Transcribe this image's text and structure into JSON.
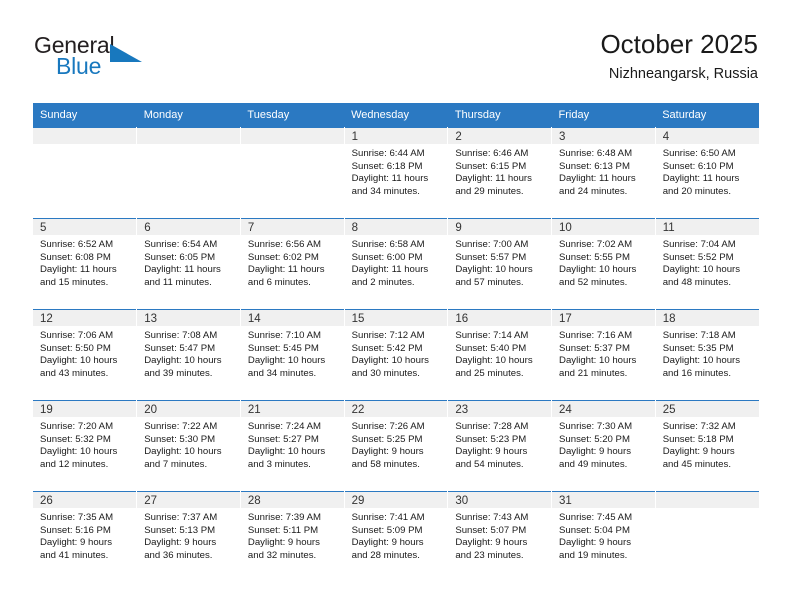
{
  "brand": {
    "name_part1": "General",
    "name_part2": "Blue",
    "triangle_icon": "triangle-icon",
    "accent_color": "#1878be"
  },
  "header": {
    "title": "October 2025",
    "subtitle": "Nizhneangarsk, Russia"
  },
  "theme": {
    "header_row_bg": "#2b79c2",
    "daynum_band_bg": "#f0f0f0",
    "text_color": "#1a1a1a"
  },
  "weekdays": [
    "Sunday",
    "Monday",
    "Tuesday",
    "Wednesday",
    "Thursday",
    "Friday",
    "Saturday"
  ],
  "weeks": [
    [
      {
        "day": "",
        "empty": true
      },
      {
        "day": "",
        "empty": true
      },
      {
        "day": "",
        "empty": true
      },
      {
        "day": "1",
        "sunrise": "Sunrise: 6:44 AM",
        "sunset": "Sunset: 6:18 PM",
        "daylight1": "Daylight: 11 hours",
        "daylight2": "and 34 minutes."
      },
      {
        "day": "2",
        "sunrise": "Sunrise: 6:46 AM",
        "sunset": "Sunset: 6:15 PM",
        "daylight1": "Daylight: 11 hours",
        "daylight2": "and 29 minutes."
      },
      {
        "day": "3",
        "sunrise": "Sunrise: 6:48 AM",
        "sunset": "Sunset: 6:13 PM",
        "daylight1": "Daylight: 11 hours",
        "daylight2": "and 24 minutes."
      },
      {
        "day": "4",
        "sunrise": "Sunrise: 6:50 AM",
        "sunset": "Sunset: 6:10 PM",
        "daylight1": "Daylight: 11 hours",
        "daylight2": "and 20 minutes."
      }
    ],
    [
      {
        "day": "5",
        "sunrise": "Sunrise: 6:52 AM",
        "sunset": "Sunset: 6:08 PM",
        "daylight1": "Daylight: 11 hours",
        "daylight2": "and 15 minutes."
      },
      {
        "day": "6",
        "sunrise": "Sunrise: 6:54 AM",
        "sunset": "Sunset: 6:05 PM",
        "daylight1": "Daylight: 11 hours",
        "daylight2": "and 11 minutes."
      },
      {
        "day": "7",
        "sunrise": "Sunrise: 6:56 AM",
        "sunset": "Sunset: 6:02 PM",
        "daylight1": "Daylight: 11 hours",
        "daylight2": "and 6 minutes."
      },
      {
        "day": "8",
        "sunrise": "Sunrise: 6:58 AM",
        "sunset": "Sunset: 6:00 PM",
        "daylight1": "Daylight: 11 hours",
        "daylight2": "and 2 minutes."
      },
      {
        "day": "9",
        "sunrise": "Sunrise: 7:00 AM",
        "sunset": "Sunset: 5:57 PM",
        "daylight1": "Daylight: 10 hours",
        "daylight2": "and 57 minutes."
      },
      {
        "day": "10",
        "sunrise": "Sunrise: 7:02 AM",
        "sunset": "Sunset: 5:55 PM",
        "daylight1": "Daylight: 10 hours",
        "daylight2": "and 52 minutes."
      },
      {
        "day": "11",
        "sunrise": "Sunrise: 7:04 AM",
        "sunset": "Sunset: 5:52 PM",
        "daylight1": "Daylight: 10 hours",
        "daylight2": "and 48 minutes."
      }
    ],
    [
      {
        "day": "12",
        "sunrise": "Sunrise: 7:06 AM",
        "sunset": "Sunset: 5:50 PM",
        "daylight1": "Daylight: 10 hours",
        "daylight2": "and 43 minutes."
      },
      {
        "day": "13",
        "sunrise": "Sunrise: 7:08 AM",
        "sunset": "Sunset: 5:47 PM",
        "daylight1": "Daylight: 10 hours",
        "daylight2": "and 39 minutes."
      },
      {
        "day": "14",
        "sunrise": "Sunrise: 7:10 AM",
        "sunset": "Sunset: 5:45 PM",
        "daylight1": "Daylight: 10 hours",
        "daylight2": "and 34 minutes."
      },
      {
        "day": "15",
        "sunrise": "Sunrise: 7:12 AM",
        "sunset": "Sunset: 5:42 PM",
        "daylight1": "Daylight: 10 hours",
        "daylight2": "and 30 minutes."
      },
      {
        "day": "16",
        "sunrise": "Sunrise: 7:14 AM",
        "sunset": "Sunset: 5:40 PM",
        "daylight1": "Daylight: 10 hours",
        "daylight2": "and 25 minutes."
      },
      {
        "day": "17",
        "sunrise": "Sunrise: 7:16 AM",
        "sunset": "Sunset: 5:37 PM",
        "daylight1": "Daylight: 10 hours",
        "daylight2": "and 21 minutes."
      },
      {
        "day": "18",
        "sunrise": "Sunrise: 7:18 AM",
        "sunset": "Sunset: 5:35 PM",
        "daylight1": "Daylight: 10 hours",
        "daylight2": "and 16 minutes."
      }
    ],
    [
      {
        "day": "19",
        "sunrise": "Sunrise: 7:20 AM",
        "sunset": "Sunset: 5:32 PM",
        "daylight1": "Daylight: 10 hours",
        "daylight2": "and 12 minutes."
      },
      {
        "day": "20",
        "sunrise": "Sunrise: 7:22 AM",
        "sunset": "Sunset: 5:30 PM",
        "daylight1": "Daylight: 10 hours",
        "daylight2": "and 7 minutes."
      },
      {
        "day": "21",
        "sunrise": "Sunrise: 7:24 AM",
        "sunset": "Sunset: 5:27 PM",
        "daylight1": "Daylight: 10 hours",
        "daylight2": "and 3 minutes."
      },
      {
        "day": "22",
        "sunrise": "Sunrise: 7:26 AM",
        "sunset": "Sunset: 5:25 PM",
        "daylight1": "Daylight: 9 hours",
        "daylight2": "and 58 minutes."
      },
      {
        "day": "23",
        "sunrise": "Sunrise: 7:28 AM",
        "sunset": "Sunset: 5:23 PM",
        "daylight1": "Daylight: 9 hours",
        "daylight2": "and 54 minutes."
      },
      {
        "day": "24",
        "sunrise": "Sunrise: 7:30 AM",
        "sunset": "Sunset: 5:20 PM",
        "daylight1": "Daylight: 9 hours",
        "daylight2": "and 49 minutes."
      },
      {
        "day": "25",
        "sunrise": "Sunrise: 7:32 AM",
        "sunset": "Sunset: 5:18 PM",
        "daylight1": "Daylight: 9 hours",
        "daylight2": "and 45 minutes."
      }
    ],
    [
      {
        "day": "26",
        "sunrise": "Sunrise: 7:35 AM",
        "sunset": "Sunset: 5:16 PM",
        "daylight1": "Daylight: 9 hours",
        "daylight2": "and 41 minutes."
      },
      {
        "day": "27",
        "sunrise": "Sunrise: 7:37 AM",
        "sunset": "Sunset: 5:13 PM",
        "daylight1": "Daylight: 9 hours",
        "daylight2": "and 36 minutes."
      },
      {
        "day": "28",
        "sunrise": "Sunrise: 7:39 AM",
        "sunset": "Sunset: 5:11 PM",
        "daylight1": "Daylight: 9 hours",
        "daylight2": "and 32 minutes."
      },
      {
        "day": "29",
        "sunrise": "Sunrise: 7:41 AM",
        "sunset": "Sunset: 5:09 PM",
        "daylight1": "Daylight: 9 hours",
        "daylight2": "and 28 minutes."
      },
      {
        "day": "30",
        "sunrise": "Sunrise: 7:43 AM",
        "sunset": "Sunset: 5:07 PM",
        "daylight1": "Daylight: 9 hours",
        "daylight2": "and 23 minutes."
      },
      {
        "day": "31",
        "sunrise": "Sunrise: 7:45 AM",
        "sunset": "Sunset: 5:04 PM",
        "daylight1": "Daylight: 9 hours",
        "daylight2": "and 19 minutes."
      },
      {
        "day": "",
        "empty": true
      }
    ]
  ]
}
